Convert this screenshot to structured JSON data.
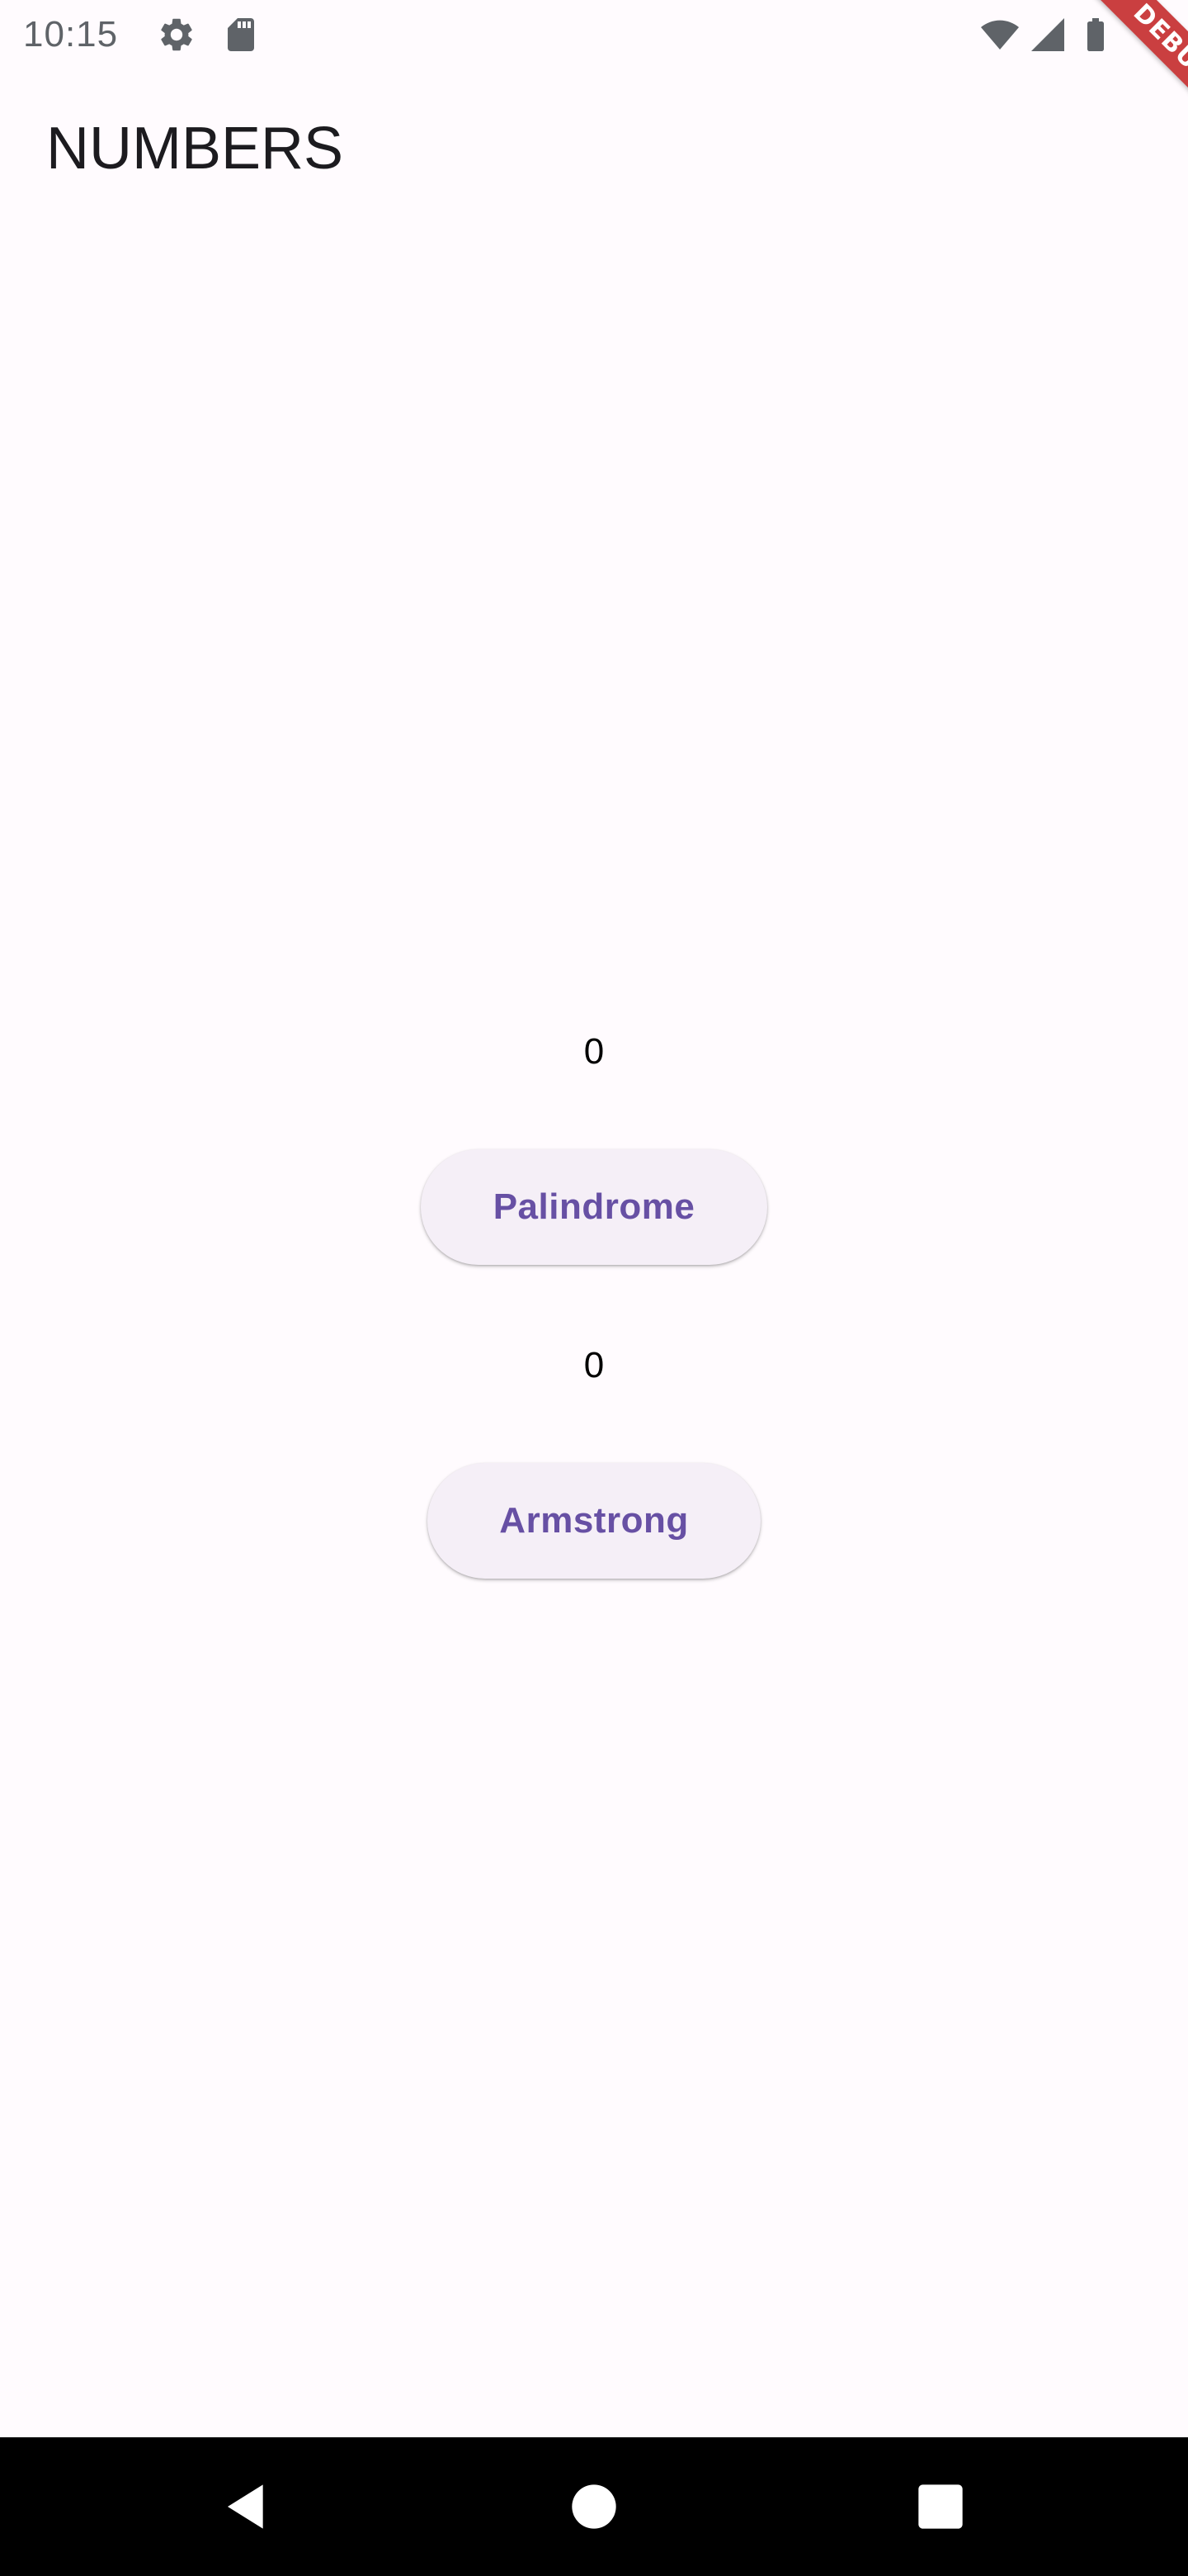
{
  "status_bar": {
    "time": "10:15",
    "icons": [
      "gear-icon",
      "sd-card-icon",
      "wifi-icon",
      "cellular-signal-icon",
      "battery-icon"
    ],
    "icon_color": "#5f6368"
  },
  "debug_banner": {
    "label": "DEBUG",
    "color": "#b80000"
  },
  "app_bar": {
    "title": "NUMBERS"
  },
  "main": {
    "palindrome": {
      "value": "0",
      "button_label": "Palindrome"
    },
    "armstrong": {
      "value": "0",
      "button_label": "Armstrong"
    }
  },
  "theme": {
    "background": "#fffbfe",
    "button_background": "#f5eff7",
    "button_text": "#6750a4"
  },
  "nav_bar": {
    "buttons": [
      "back-icon",
      "home-icon",
      "recents-icon"
    ]
  }
}
